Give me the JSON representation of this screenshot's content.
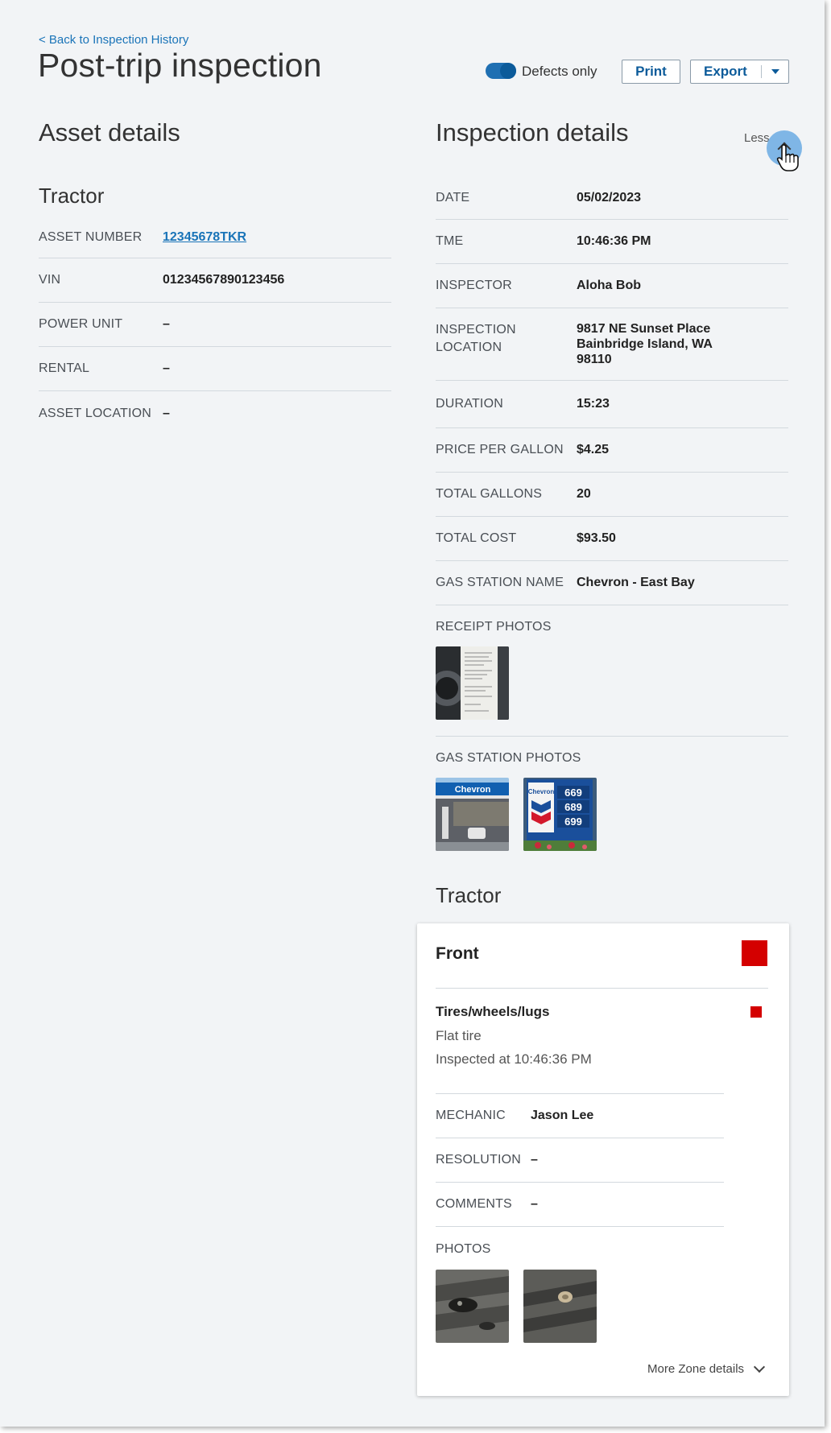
{
  "header": {
    "back_link": "< Back to Inspection History",
    "title": "Post-trip inspection",
    "defects_toggle_label": "Defects only",
    "defects_toggle_on": true,
    "print_label": "Print",
    "export_label": "Export"
  },
  "asset": {
    "section_title": "Asset details",
    "subtitle": "Tractor",
    "rows": [
      {
        "label": "ASSET NUMBER",
        "value": "12345678TKR"
      },
      {
        "label": "VIN",
        "value": "01234567890123456"
      },
      {
        "label": "POWER UNIT",
        "value": "–"
      },
      {
        "label": "RENTAL",
        "value": "–"
      },
      {
        "label": "ASSET LOCATION",
        "value": "–"
      }
    ]
  },
  "inspection": {
    "section_title": "Inspection details",
    "less_label": "Less",
    "rows": [
      {
        "label": "DATE",
        "value": "05/02/2023"
      },
      {
        "label": "TME",
        "value": "10:46:36 PM"
      },
      {
        "label": "INSPECTOR",
        "value": "Aloha Bob"
      },
      {
        "label": "INSPECTION LOCATION",
        "label_line1": "INSPECTION",
        "label_line2": "LOCATION",
        "value_line1": "9817 NE Sunset Place",
        "value_line2": "Bainbridge Island, WA",
        "value_line3": "98110"
      },
      {
        "label": "DURATION",
        "value": "15:23"
      },
      {
        "label": "PRICE PER GALLON",
        "value": "$4.25"
      },
      {
        "label": "TOTAL GALLONS",
        "value": "20"
      },
      {
        "label": "TOTAL COST",
        "value": "$93.50"
      },
      {
        "label": "GAS STATION NAME",
        "value": "Chevron - East Bay"
      }
    ],
    "receipt_photos_label": "RECEIPT PHOTOS",
    "gas_station_photos_label": "GAS STATION PHOTOS",
    "gas_photo_brand": "Chevron",
    "gas_prices": [
      "669",
      "689",
      "699"
    ]
  },
  "zone": {
    "section_title": "Tractor",
    "card_title": "Front",
    "status_color": "#d40000",
    "item_title": "Tires/wheels/lugs",
    "item_defect": "Flat tire",
    "item_time": "Inspected at 10:46:36 PM",
    "rows": [
      {
        "label": "MECHANIC",
        "value": "Jason Lee"
      },
      {
        "label": "RESOLUTION",
        "value": "–"
      },
      {
        "label": "COMMENTS",
        "value": "–"
      }
    ],
    "photos_label": "PHOTOS",
    "more_label": "More Zone details"
  }
}
